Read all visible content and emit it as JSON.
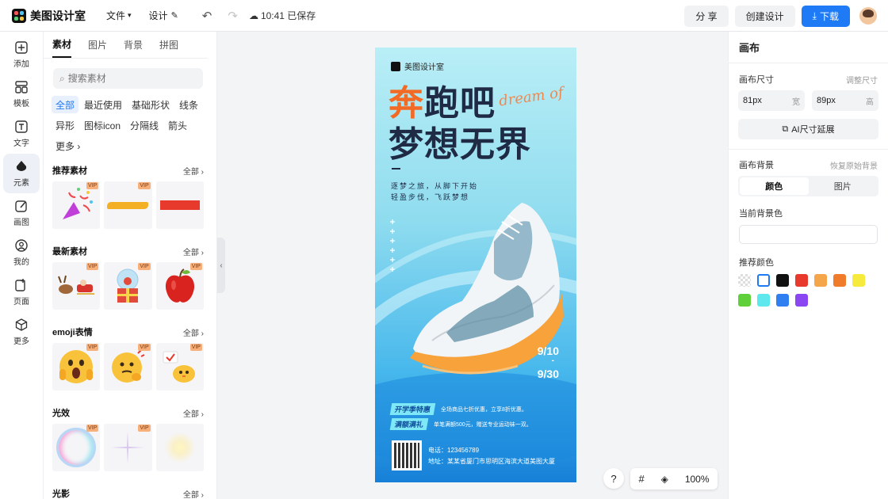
{
  "app": {
    "name": "美图设计室"
  },
  "topbar": {
    "file_label": "文件",
    "design_label": "设计",
    "save_status": "10:41 已保存",
    "share_label": "分 享",
    "create_label": "创建设计",
    "download_label": "下载",
    "vip_label": "VIP"
  },
  "rail": {
    "items": [
      {
        "label": "添加",
        "icon": "plus-icon"
      },
      {
        "label": "模板",
        "icon": "template-icon"
      },
      {
        "label": "文字",
        "icon": "text-icon"
      },
      {
        "label": "元素",
        "icon": "shapes-icon"
      },
      {
        "label": "画图",
        "icon": "pen-icon"
      },
      {
        "label": "我的",
        "icon": "user-icon"
      },
      {
        "label": "页面",
        "icon": "page-icon"
      },
      {
        "label": "更多",
        "icon": "cube-icon"
      }
    ]
  },
  "panel": {
    "tabs": [
      "素材",
      "图片",
      "背景",
      "拼图"
    ],
    "search_placeholder": "搜索素材",
    "chips": [
      "全部",
      "最近使用",
      "基础形状",
      "线条",
      "异形",
      "图标icon",
      "分隔线",
      "箭头",
      "更多 ›"
    ],
    "all_label": "全部",
    "vip_label": "VIP",
    "sections": [
      {
        "title": "推荐素材"
      },
      {
        "title": "最新素材"
      },
      {
        "title": "emoji表情"
      },
      {
        "title": "光效"
      },
      {
        "title": "光影"
      }
    ]
  },
  "poster": {
    "brand": "美图设计室",
    "title_orange": "奔",
    "title_rest": "跑吧",
    "title_line2": "梦想无界",
    "script": "dream of",
    "line1": "逐梦之旅，从脚下开始",
    "line2": "轻盈步伐，飞跃梦想",
    "date_start": "9/10",
    "date_dash": "-",
    "date_end": "9/30",
    "tag1": "开学季特惠",
    "desc1": "全场商品七折优惠，立享8折优惠。",
    "tag2": "满额满礼",
    "desc2": "单笔满额500元，赠送专业运动袜一双。",
    "phone": "电话：123456789",
    "address": "地址：某某省厦门市思明区海滨大道美图大厦"
  },
  "zoom": {
    "help": "?",
    "level": "100%"
  },
  "right": {
    "header": "画布",
    "size_label": "画布尺寸",
    "size_adjust": "调整尺寸",
    "width_value": "81px",
    "width_unit": "宽",
    "height_value": "89px",
    "height_unit": "高",
    "ai_label": "AI尺寸延展",
    "bg_label": "画布背景",
    "bg_reset": "恢复原始背景",
    "seg_color": "颜色",
    "seg_image": "图片",
    "current_bg": "当前背景色",
    "rec_colors": "推荐颜色",
    "swatches": [
      "transparent",
      "#ffffff",
      "#111111",
      "#e8392d",
      "#f5a64a",
      "#f07b2a",
      "#f6ea3c",
      "#5fd03a",
      "#5ee8ee",
      "#2f7ff0",
      "#8a46f0"
    ]
  }
}
